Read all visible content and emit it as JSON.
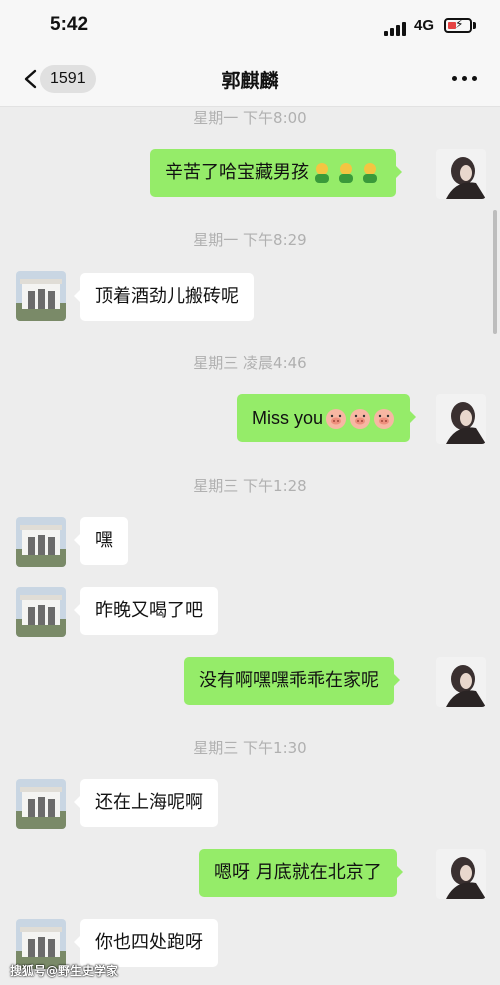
{
  "status_bar": {
    "time": "5:42",
    "network": "4G"
  },
  "nav": {
    "back_count": "1591",
    "title": "郭麒麟"
  },
  "messages": [
    {
      "kind": "timestamp",
      "text": "星期一 下午8:00"
    },
    {
      "kind": "sent",
      "text": "辛苦了哈宝藏男孩",
      "emojis": [
        "person-emoji",
        "person-emoji",
        "person-emoji"
      ]
    },
    {
      "kind": "timestamp",
      "text": "星期一 下午8:29"
    },
    {
      "kind": "received",
      "text": "顶着酒劲儿搬砖呢"
    },
    {
      "kind": "timestamp",
      "text": "星期三 凌晨4:46"
    },
    {
      "kind": "sent",
      "text": "Miss you",
      "emojis": [
        "pig-emoji",
        "pig-emoji",
        "pig-emoji"
      ]
    },
    {
      "kind": "timestamp",
      "text": "星期三 下午1:28"
    },
    {
      "kind": "received",
      "text": "嘿"
    },
    {
      "kind": "received",
      "text": "昨晚又喝了吧"
    },
    {
      "kind": "sent",
      "text": "没有啊嘿嘿乖乖在家呢"
    },
    {
      "kind": "timestamp",
      "text": "星期三 下午1:30"
    },
    {
      "kind": "received",
      "text": "还在上海呢啊"
    },
    {
      "kind": "sent",
      "text": "嗯呀 月底就在北京了"
    },
    {
      "kind": "received",
      "text": "你也四处跑呀"
    }
  ],
  "watermark": "搜狐号@野生史学家"
}
